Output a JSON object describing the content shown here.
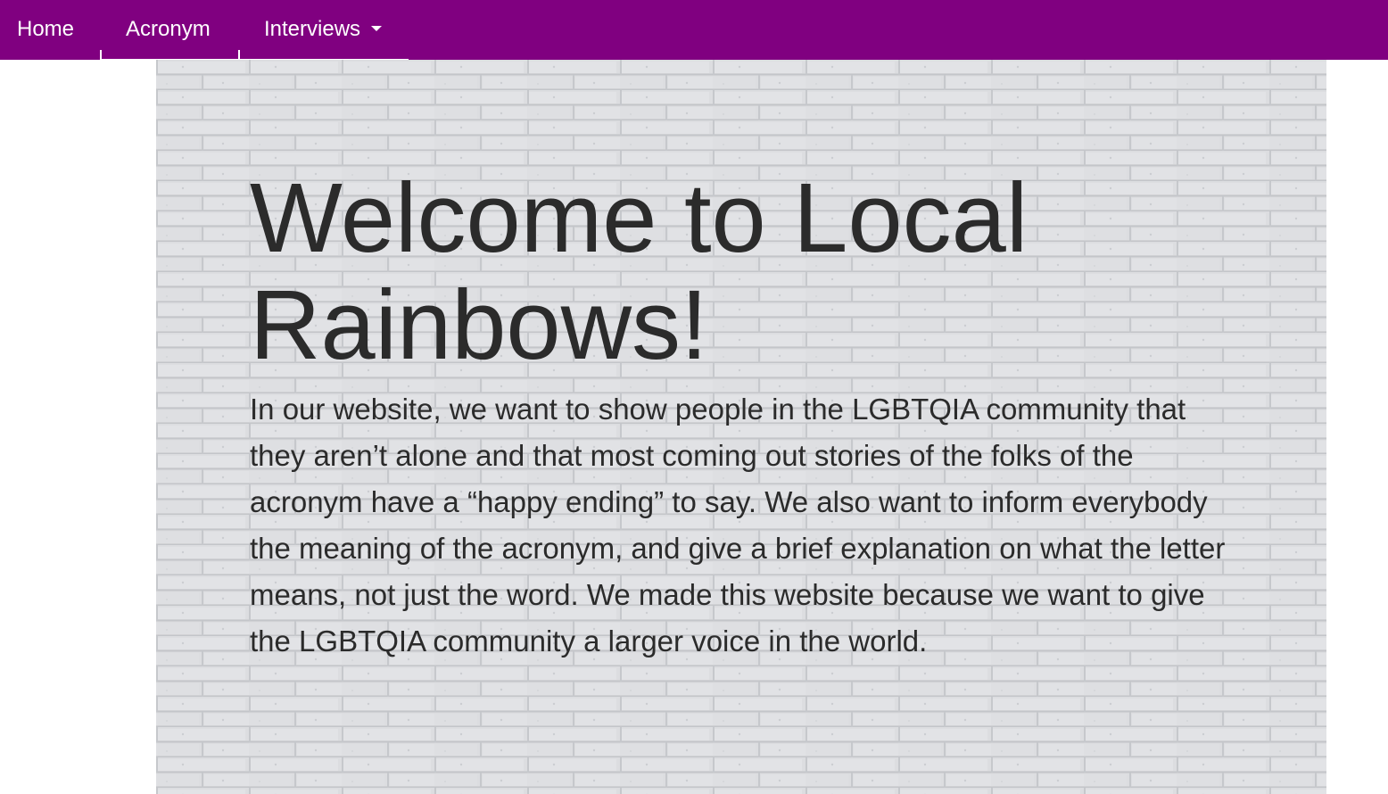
{
  "nav": {
    "home_label": "Home",
    "acronym_label": "Acronym",
    "interviews_label": "Interviews",
    "interviews_icon": "caret-down-icon",
    "background_color": "#800080"
  },
  "main": {
    "title": "Welcome to Local Rainbows!",
    "intro": "In our website, we want to show people in the LGBTQIA community that they aren’t alone and that most coming out stories of the folks of the acronym have a “happy ending” to say. We also want to inform everybody the meaning of the acronym, and give a brief explanation on what the letter means, not just the word. We made this website because we want to give the LGBTQIA community a larger voice in the world.",
    "background": "white-brick-wall"
  }
}
